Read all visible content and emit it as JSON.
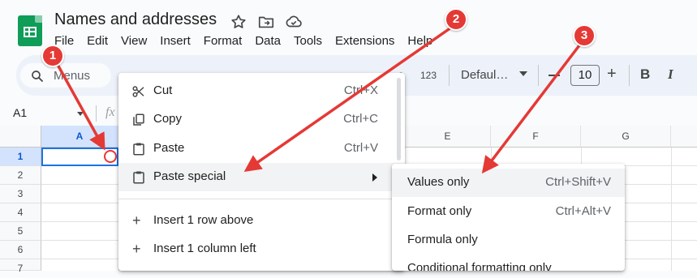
{
  "header": {
    "doc_title": "Names and addresses",
    "menu": [
      "File",
      "Edit",
      "View",
      "Insert",
      "Format",
      "Data",
      "Tools",
      "Extensions",
      "Help"
    ]
  },
  "toolbar": {
    "menus_label": "Menus",
    "number_format": "123",
    "font_name": "Defaul…",
    "font_size": "10",
    "plus": "+",
    "bold": "B",
    "italic": "I"
  },
  "formula_bar": {
    "cell_ref": "A1",
    "fx": "fx"
  },
  "grid": {
    "columns": [
      "A",
      "E",
      "F",
      "G"
    ],
    "rows": [
      "1",
      "2",
      "3",
      "4",
      "5",
      "6",
      "7"
    ]
  },
  "context_menu": {
    "items": [
      {
        "label": "Cut",
        "shortcut": "Ctrl+X",
        "icon": "scissors-icon"
      },
      {
        "label": "Copy",
        "shortcut": "Ctrl+C",
        "icon": "copy-icon"
      },
      {
        "label": "Paste",
        "shortcut": "Ctrl+V",
        "icon": "clipboard-icon"
      },
      {
        "label": "Paste special",
        "shortcut": "",
        "icon": "clipboard-icon"
      },
      {
        "label": "Insert 1 row above",
        "shortcut": "",
        "icon": "plus-icon"
      },
      {
        "label": "Insert 1 column left",
        "shortcut": "",
        "icon": "plus-icon"
      }
    ]
  },
  "paste_special_menu": {
    "items": [
      {
        "label": "Values only",
        "shortcut": "Ctrl+Shift+V"
      },
      {
        "label": "Format only",
        "shortcut": "Ctrl+Alt+V"
      },
      {
        "label": "Formula only",
        "shortcut": ""
      },
      {
        "label": "Conditional formatting only",
        "shortcut": ""
      }
    ]
  },
  "annotations": {
    "markers": [
      "1",
      "2",
      "3"
    ],
    "color": "#e53935"
  },
  "colors": {
    "sheets_green": "#0f9d58",
    "selection_blue": "#1a73e8",
    "toolbar_bg": "#edf2fa"
  }
}
